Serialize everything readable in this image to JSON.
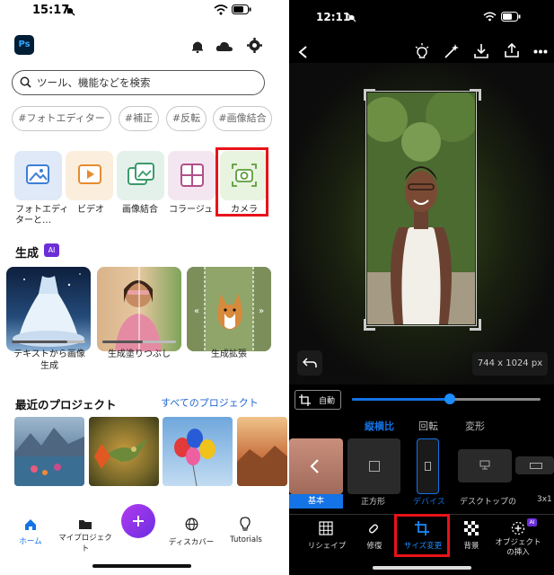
{
  "left": {
    "status": {
      "time": "15:17"
    },
    "app_icon_text": "Ps",
    "search": {
      "placeholder": "ツール、機能などを検索"
    },
    "chips": [
      "#フォトエディター",
      "#補正",
      "#反転",
      "#画像結合"
    ],
    "tools": [
      {
        "label_line1": "フォトエディ",
        "label_line2": "ターと…"
      },
      {
        "label_line1": "ビデオ",
        "label_line2": ""
      },
      {
        "label_line1": "画像結合",
        "label_line2": ""
      },
      {
        "label_line1": "コラージュ",
        "label_line2": ""
      },
      {
        "label_line1": "カメラ",
        "label_line2": ""
      }
    ],
    "section_generate": {
      "title": "生成",
      "badge": "AI"
    },
    "gen_cards": [
      {
        "label_line1": "テキストから画像",
        "label_line2": "生成"
      },
      {
        "label_line1": "生成塗りつぶし",
        "label_line2": ""
      },
      {
        "label_line1": "生成拡張",
        "label_line2": ""
      }
    ],
    "recent": {
      "title": "最近のプロジェクト",
      "link": "すべてのプロジェクト"
    },
    "bottom_nav": {
      "home": "ホーム",
      "projects": "マイプロジェクト",
      "discover": "ディスカバー",
      "tutorials": "Tutorials"
    }
  },
  "right": {
    "status": {
      "time": "12:11"
    },
    "size_readout": "744 x 1024 px",
    "auto_label": "自動",
    "slider_value": 0.52,
    "sub_tabs": {
      "aspect": "縦横比",
      "rotate": "回転",
      "transform": "変形"
    },
    "presets": {
      "basic": "基本",
      "square": "正方形",
      "device": "デバイス",
      "desktop": "デスクトップの",
      "ratio": "3x1"
    },
    "bottom_tools": {
      "reshape": "リシェイプ",
      "repair": "修復",
      "resize": "サイズ変更",
      "background": "背景",
      "insert_line1": "オブジェクト",
      "insert_line2": "の挿入",
      "badge_ai": "AI"
    }
  },
  "colors": {
    "highlight_red": "#e8121a",
    "accent_blue": "#1473e6",
    "link_blue": "#2066d1",
    "ai_purple": "#6b2ed8",
    "fab_purple": "#8a2be2"
  }
}
